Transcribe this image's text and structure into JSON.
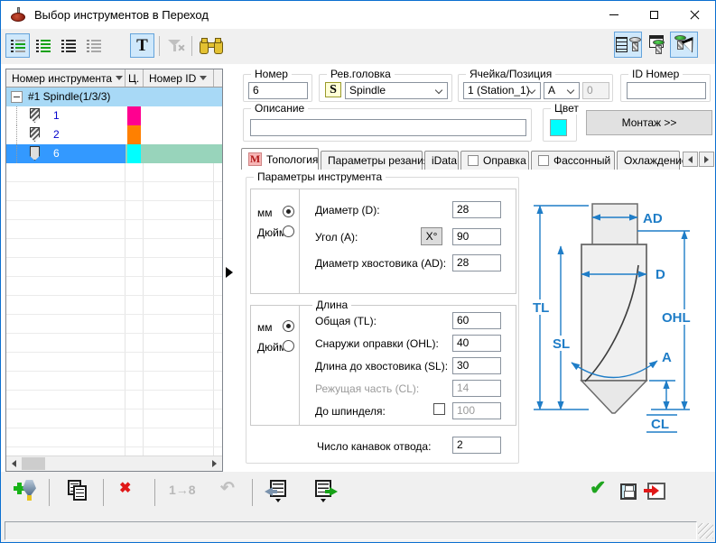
{
  "window": {
    "title": "Выбор инструментов в Переход"
  },
  "colors": {
    "selection_blue": "#3399ff",
    "group_row_blue": "#a8d9f6",
    "selection_green": "#98d4bb",
    "dimension_blue": "#1f7dc7"
  },
  "toolbar": {
    "t_label": "T"
  },
  "left_table": {
    "columns": [
      "Номер инструмента",
      "Ц.",
      "Номер ID"
    ],
    "group_row": "#1 Spindle(1/3/3)",
    "rows": [
      {
        "number": "1",
        "color": "#ff0090"
      },
      {
        "number": "2",
        "color": "#ff8000"
      },
      {
        "number": "6",
        "color": "#00ffff"
      }
    ]
  },
  "header_fields": {
    "number_label": "Номер",
    "number_value": "6",
    "head_label": "Рев.головка",
    "head_icon": "S",
    "head_value": "Spindle",
    "cell_label": "Ячейка/Позиция",
    "cell_value": "1 (Station_1)",
    "position_value": "A",
    "index_value": "0",
    "id_label": "ID Номер",
    "id_value": "",
    "description_label": "Описание",
    "description_value": "",
    "color_label": "Цвет",
    "mount_button": "Монтаж >>"
  },
  "tabs": {
    "topology": "Топология",
    "topology_icon": "M",
    "cutting": "Параметры резания",
    "idata": "iData",
    "holder": "Оправка",
    "shaped": "Фассонный",
    "cooling": "Охлаждение"
  },
  "topology": {
    "group_title": "Параметры инструмента",
    "unit_mm": "мм",
    "unit_inch": "Дюйм",
    "diameter_label": "Диаметр (D):",
    "diameter_value": "28",
    "angle_label": "Угол (A):",
    "angle_button": "X°",
    "angle_value": "90",
    "shank_label": "Диаметр хвостовика (AD):",
    "shank_value": "28",
    "length_title": "Длина",
    "total_label": "Общая (TL):",
    "total_value": "60",
    "ohl_label": "Снаружи оправки (OHL):",
    "ohl_value": "40",
    "sl_label": "Длина до хвостовика (SL):",
    "sl_value": "30",
    "cl_label": "Режущая часть (CL):",
    "cl_value": "14",
    "spindle_label": "До шпинделя:",
    "spindle_value": "100",
    "flutes_label": "Число канавок отвода:",
    "flutes_value": "2"
  },
  "diagram": {
    "ad": "AD",
    "d": "D",
    "tl": "TL",
    "sl": "SL",
    "ohl": "OHL",
    "a": "A",
    "cl": "CL"
  },
  "bottom_toolbar": {
    "renumber": "1→8",
    "undo": "↶",
    "delete": "✖",
    "confirm": "✔"
  },
  "statusbar": {
    "text": ""
  }
}
